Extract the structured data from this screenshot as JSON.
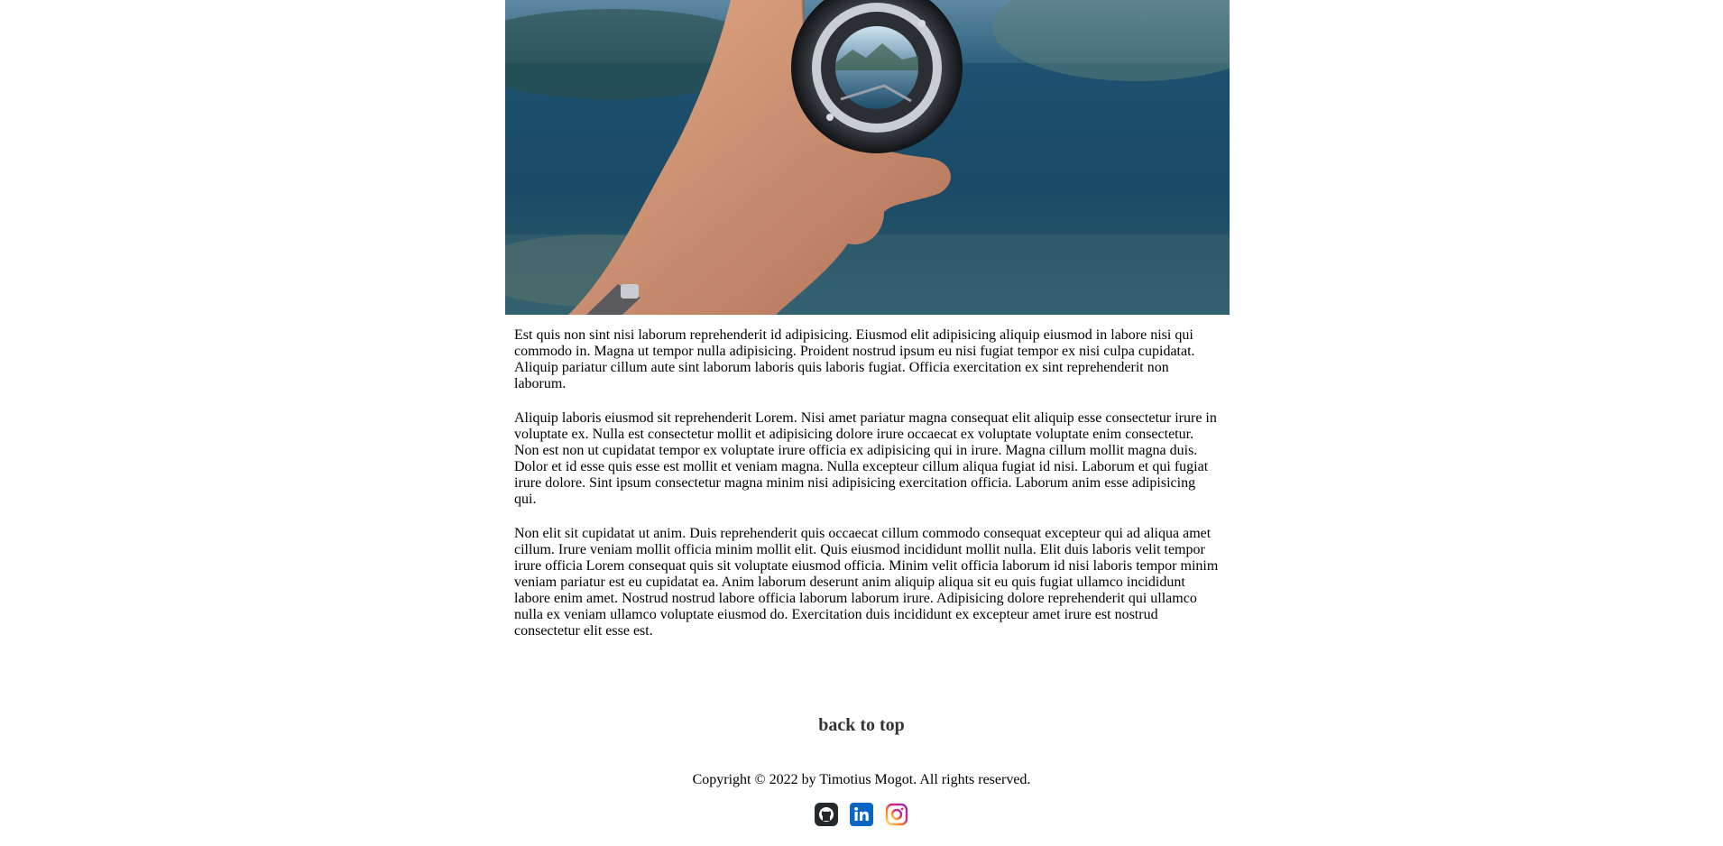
{
  "hero": {
    "alt": "Hand holding a camera lens in front of a lake and mountains"
  },
  "article": {
    "paragraphs": [
      "Est quis non sint nisi laborum reprehenderit id adipisicing. Eiusmod elit adipisicing aliquip eiusmod in labore nisi qui commodo in. Magna ut tempor nulla adipisicing. Proident nostrud ipsum eu nisi fugiat tempor ex nisi culpa cupidatat. Aliquip pariatur cillum aute sint laborum laboris quis laboris fugiat. Officia exercitation ex sint reprehenderit non laborum.",
      "Aliquip laboris eiusmod sit reprehenderit Lorem. Nisi amet pariatur magna consequat elit aliquip esse consectetur irure in voluptate ex. Nulla est consectetur mollit et adipisicing dolore irure occaecat ex voluptate voluptate enim consectetur. Non est non ut cupidatat tempor ex voluptate irure officia ex adipisicing qui in irure. Magna cillum mollit magna duis. Dolor et id esse quis esse est mollit et veniam magna. Nulla excepteur cillum aliqua fugiat id nisi. Laborum et qui fugiat irure dolore. Sint ipsum consectetur magna minim nisi adipisicing exercitation officia. Laborum anim esse adipisicing qui.",
      "Non elit sit cupidatat ut anim. Duis reprehenderit quis occaecat cillum commodo consequat excepteur qui ad aliqua amet cillum. Irure veniam mollit officia minim mollit elit. Quis eiusmod incididunt mollit nulla. Elit duis laboris velit tempor irure officia Lorem consequat quis sit voluptate eiusmod officia. Minim velit officia laborum id nisi laboris tempor minim veniam pariatur est eu cupidatat ea. Anim laborum deserunt anim aliquip aliqua sit eu quis fugiat ullamco incididunt labore enim amet. Nostrud nostrud labore officia laborum laborum irure. Adipisicing dolore reprehenderit qui ullamco nulla ex veniam ullamco voluptate eiusmod do. Exercitation duis incididunt ex excepteur amet irure est nostrud consectetur elit esse est."
    ]
  },
  "nav": {
    "back_to_top": "back to top"
  },
  "footer": {
    "copyright": "Copyright © 2022 by Timotius Mogot. All rights reserved.",
    "socials": [
      {
        "name": "github-icon",
        "color": "#24292e"
      },
      {
        "name": "linkedin-icon",
        "color": "#0a66c2"
      },
      {
        "name": "instagram-icon",
        "color": "#d62976"
      }
    ]
  }
}
